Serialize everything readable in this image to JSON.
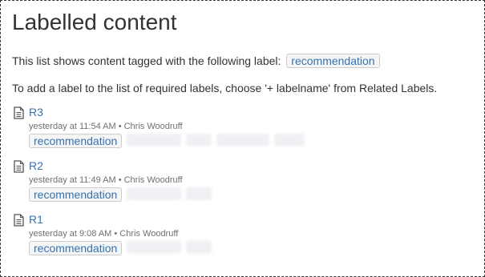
{
  "page": {
    "title": "Labelled content",
    "intro_text": "This list shows content tagged with the following label:",
    "current_label": "recommendation",
    "instructions": "To add a label to the list of required labels, choose '+ labelname' from Related Labels."
  },
  "results": [
    {
      "icon": "page-icon",
      "title": "R3",
      "meta": "yesterday at 11:54 AM • Chris Woodruff",
      "labels": [
        "recommendation"
      ],
      "blurred_labels": 4
    },
    {
      "icon": "page-icon",
      "title": "R2",
      "meta": "yesterday at 11:49 AM • Chris Woodruff",
      "labels": [
        "recommendation"
      ],
      "blurred_labels": 2
    },
    {
      "icon": "page-icon",
      "title": "R1",
      "meta": "yesterday at 9:08 AM • Chris Woodruff",
      "labels": [
        "recommendation"
      ],
      "blurred_labels": 2
    }
  ]
}
